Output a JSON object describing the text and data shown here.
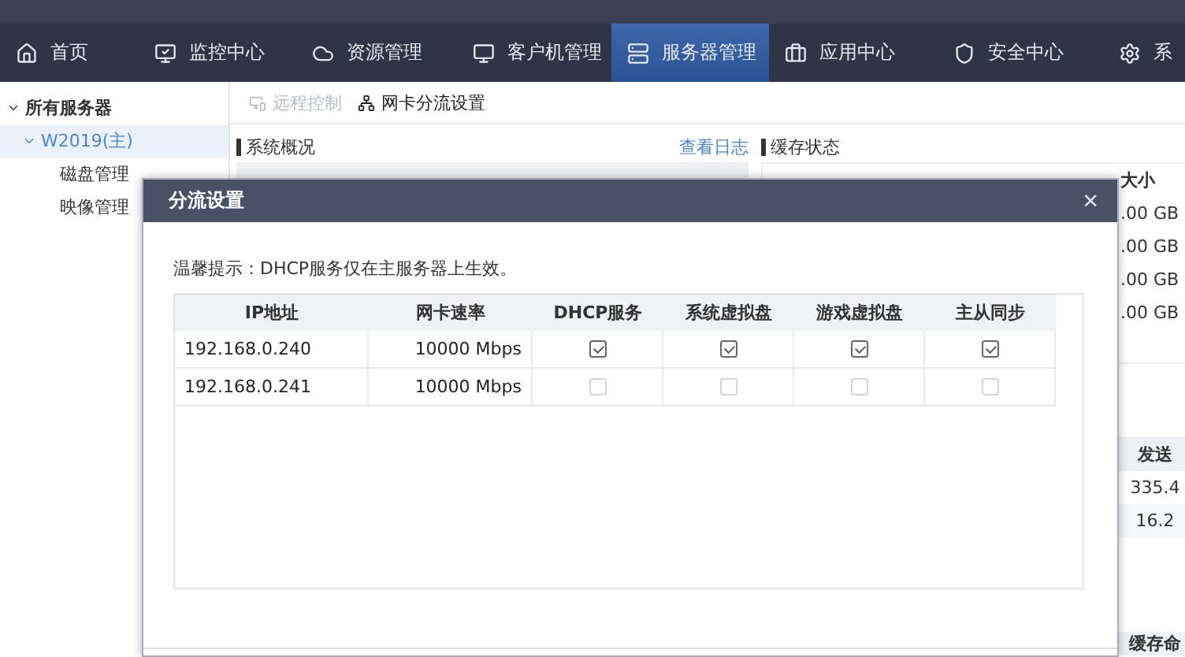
{
  "nav": {
    "tabs": [
      {
        "label": "首页",
        "selected": false
      },
      {
        "label": "监控中心",
        "selected": false
      },
      {
        "label": "资源管理",
        "selected": false
      },
      {
        "label": "客户机管理",
        "selected": false
      },
      {
        "label": "服务器管理",
        "selected": true
      },
      {
        "label": "应用中心",
        "selected": false
      },
      {
        "label": "安全中心",
        "selected": false
      },
      {
        "label": "系",
        "selected": false
      }
    ]
  },
  "sidebar": {
    "tree": [
      {
        "label": "所有服务器",
        "expanded": true,
        "selected": false,
        "children": [
          {
            "label": "W2019(主)",
            "expanded": true,
            "selected": true,
            "children": [
              {
                "label": "磁盘管理",
                "selected": false
              },
              {
                "label": "映像管理",
                "selected": false
              }
            ]
          }
        ]
      }
    ]
  },
  "toolbar": [
    {
      "label": "远程控制",
      "disabled": true
    },
    {
      "label": "网卡分流设置",
      "disabled": false
    }
  ],
  "overview": {
    "title": "系统概况",
    "link": "查看日志"
  },
  "cache": {
    "title": "缓存状态",
    "column_header": "大小",
    "cells": [
      ".00 GB",
      ".00 GB",
      ".00 GB",
      ".00 GB"
    ],
    "send_header": "发送",
    "send_cells": [
      "335.4",
      "16.2"
    ],
    "footer_header": "缓存命"
  },
  "dialog": {
    "title": "分流设置",
    "close": "×",
    "hint": "温馨提示：DHCP服务仅在主服务器上生效。",
    "columns": [
      "IP地址",
      "网卡速率",
      "DHCP服务",
      "系统虚拟盘",
      "游戏虚拟盘",
      "主从同步"
    ],
    "rows": [
      {
        "ip": "192.168.0.240",
        "speed": "10000 Mbps",
        "options": [
          {
            "checked": true
          },
          {
            "checked": true
          },
          {
            "checked": true
          },
          {
            "checked": true
          }
        ]
      },
      {
        "ip": "192.168.0.241",
        "speed": "10000 Mbps",
        "options": [
          {
            "checked": false
          },
          {
            "checked": false
          },
          {
            "checked": false
          },
          {
            "checked": false
          }
        ]
      }
    ]
  }
}
